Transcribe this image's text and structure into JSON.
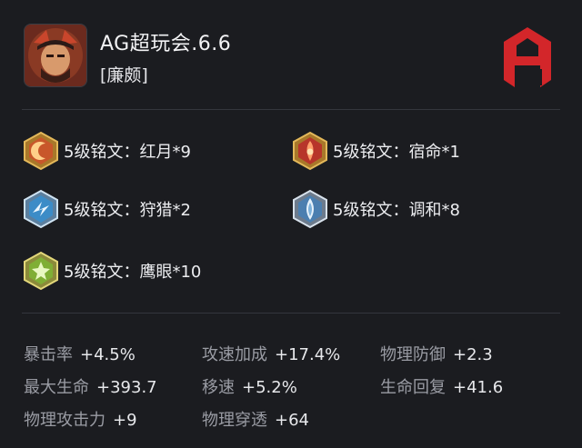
{
  "header": {
    "title": "AG超玩会.6.6",
    "hero_name": "[廉颇]",
    "avatar_icon": "hero-portrait-icon",
    "brand_icon": "ag-logo-icon",
    "brand_color": "#d3262a"
  },
  "runes": [
    {
      "label": "5级铭文：红月*9",
      "icon": "red-moon-rune-icon",
      "color": "#c8572a"
    },
    {
      "label": "5级铭文：宿命*1",
      "icon": "destiny-rune-icon",
      "color": "#c2402a"
    },
    {
      "label": "5级铭文：狩猎*2",
      "icon": "hunt-rune-icon",
      "color": "#6fb2d8"
    },
    {
      "label": "5级铭文：调和*8",
      "icon": "harmony-rune-icon",
      "color": "#5f95c4"
    },
    {
      "label": "5级铭文：鹰眼*10",
      "icon": "hawk-eye-rune-icon",
      "color": "#8fbf3f"
    }
  ],
  "stats": [
    {
      "name": "暴击率",
      "value": "+4.5%"
    },
    {
      "name": "攻速加成",
      "value": "+17.4%"
    },
    {
      "name": "物理防御",
      "value": "+2.3"
    },
    {
      "name": "最大生命",
      "value": "+393.7"
    },
    {
      "name": "移速",
      "value": "+5.2%"
    },
    {
      "name": "生命回复",
      "value": "+41.6"
    },
    {
      "name": "物理攻击力",
      "value": "+9"
    },
    {
      "name": "物理穿透",
      "value": "+64"
    }
  ]
}
